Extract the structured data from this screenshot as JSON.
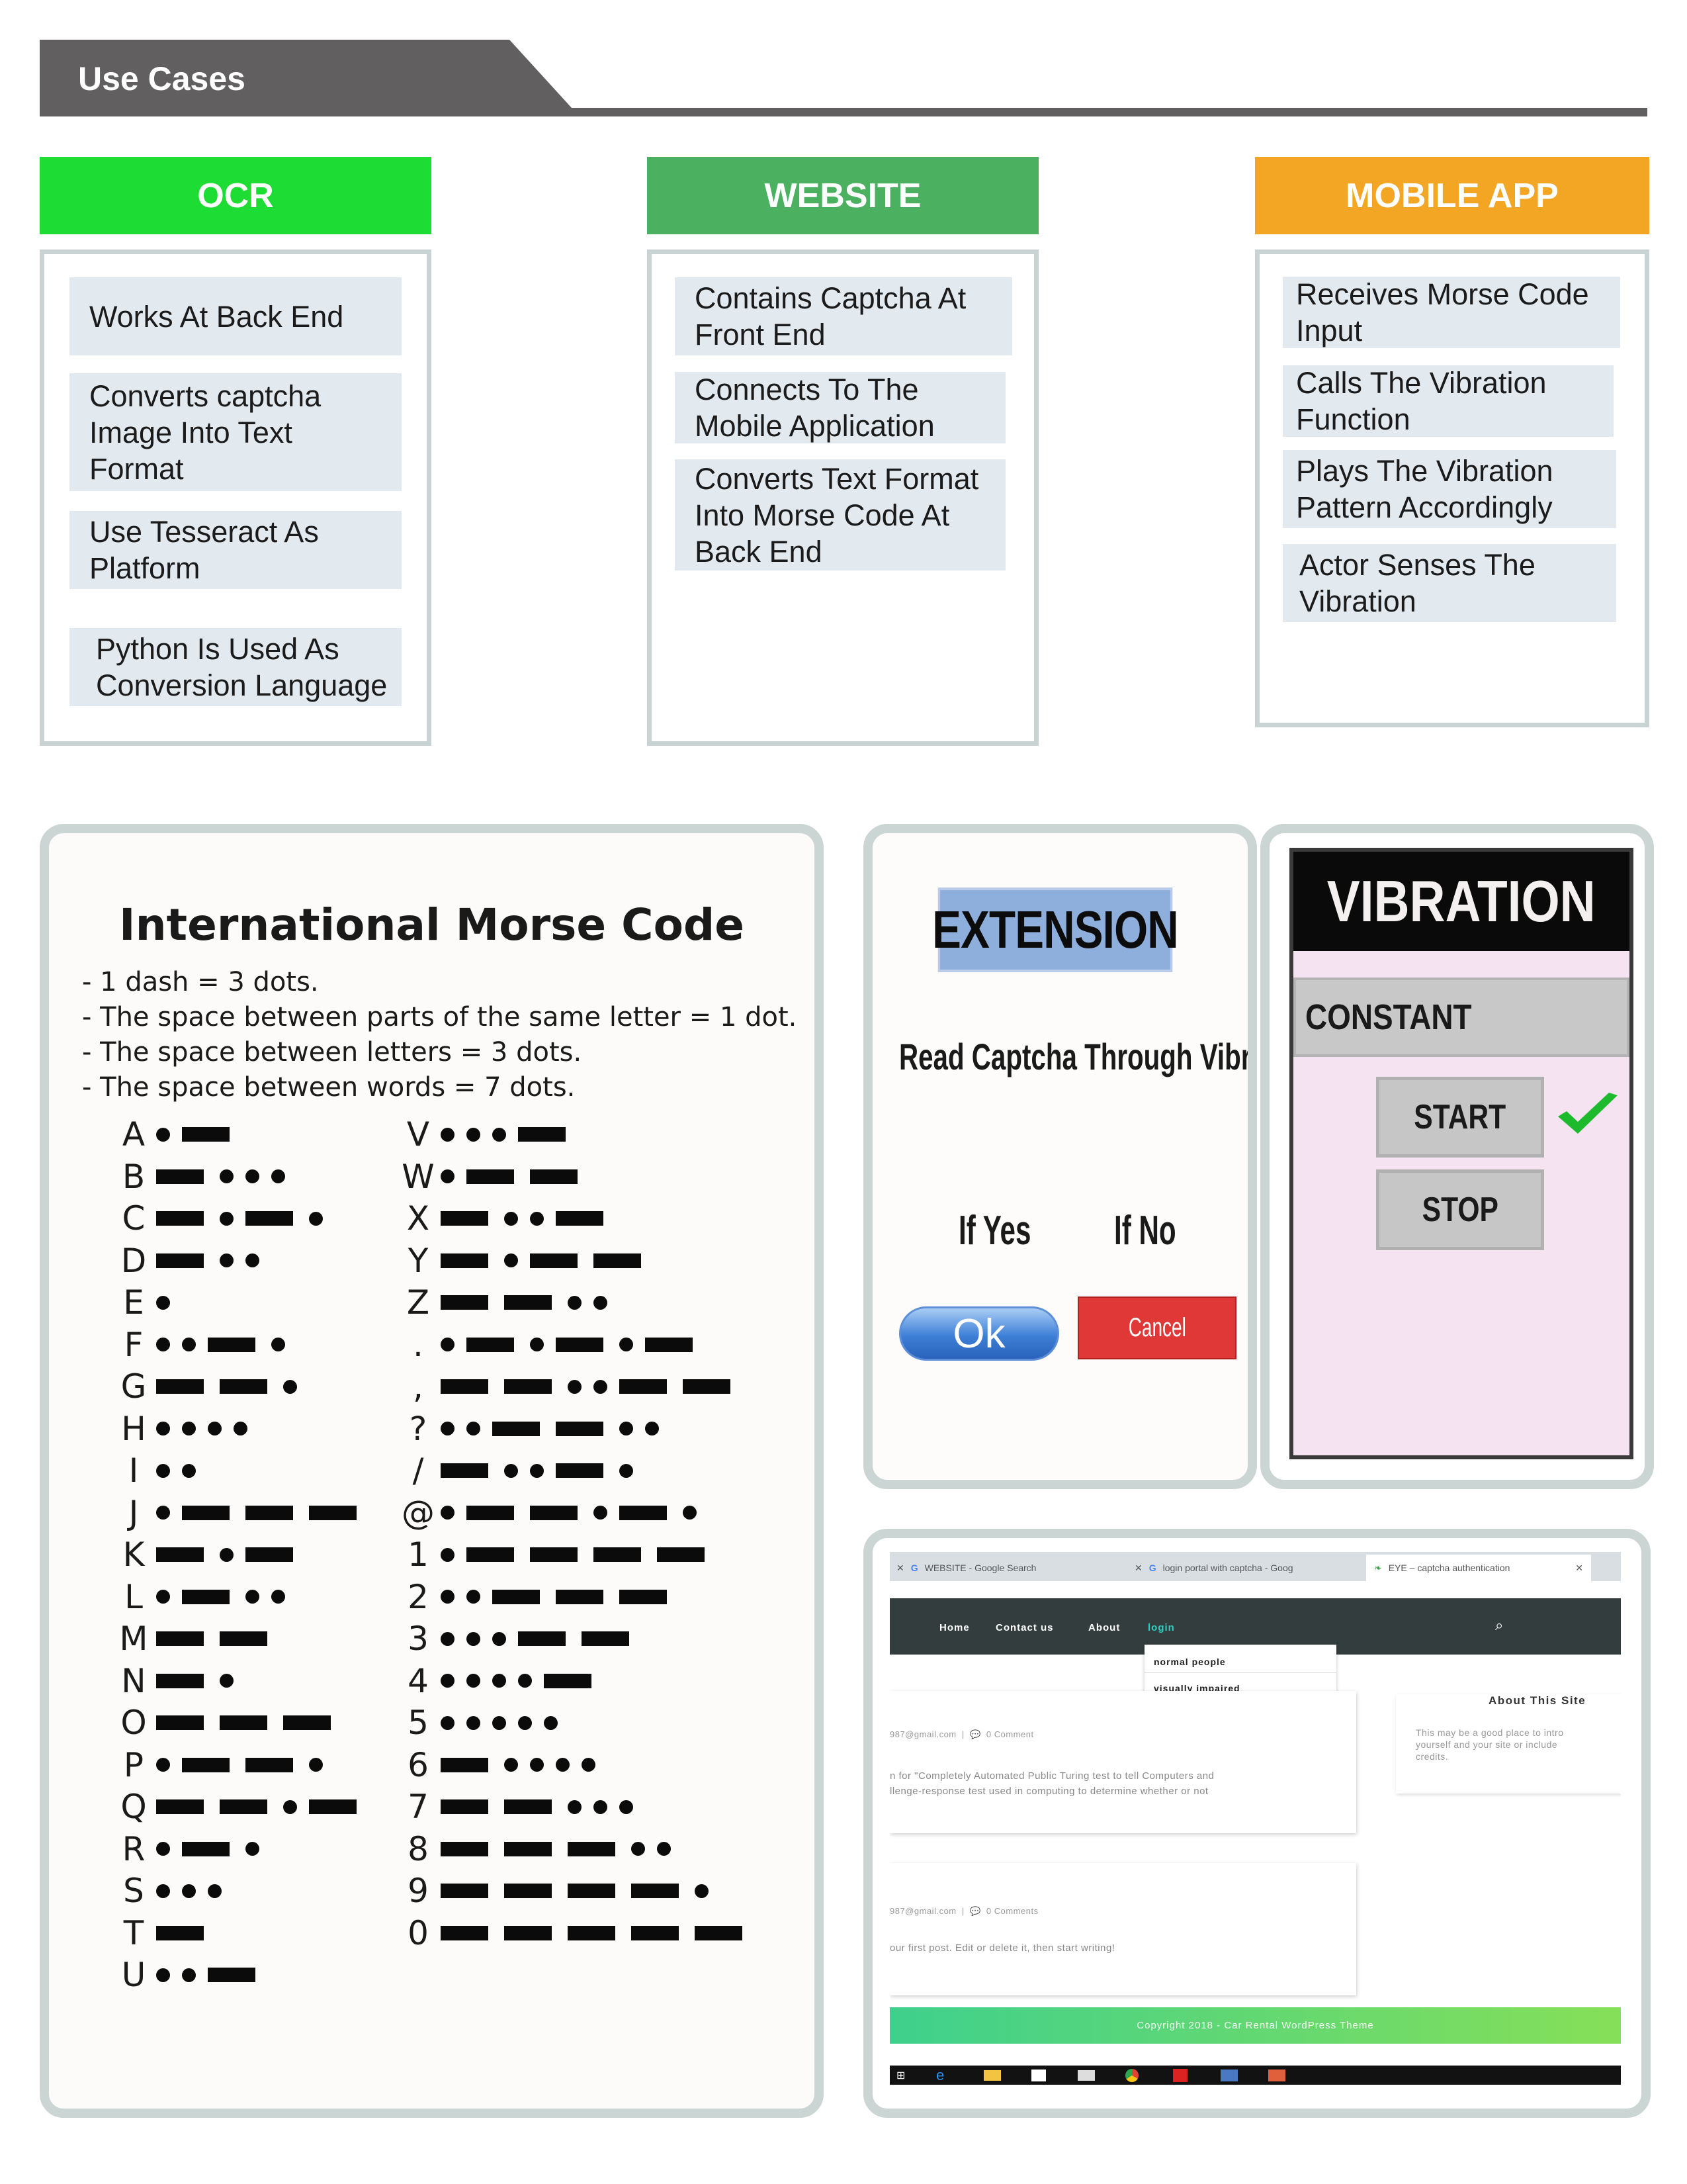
{
  "header": {
    "title": "Use Cases"
  },
  "columns": [
    {
      "title": "OCR",
      "color": "#1ddd34",
      "items": [
        "Works At Back End",
        "Converts captcha Image Into Text Format",
        "Use Tesseract As Platform",
        "Python Is Used As Conversion Language"
      ]
    },
    {
      "title": "WEBSITE",
      "color": "#4cb061",
      "items": [
        "Contains Captcha At Front End",
        "Connects To The Mobile Application",
        "Converts Text Format Into Morse Code At Back End"
      ]
    },
    {
      "title": "MOBILE APP",
      "color": "#f2a624",
      "items": [
        "Receives Morse Code Input",
        "Calls The Vibration Function",
        "Plays The Vibration Pattern Accordingly",
        "Actor Senses The Vibration"
      ]
    }
  ],
  "morse": {
    "title": "International Morse Code",
    "rules": [
      "- 1 dash = 3 dots.",
      "- The space between parts of the same letter = 1 dot.",
      "- The space between letters = 3 dots.",
      "- The space between words = 7 dots."
    ],
    "left": [
      {
        "char": "A",
        "code": ".-"
      },
      {
        "char": "B",
        "code": "-..."
      },
      {
        "char": "C",
        "code": "-.-."
      },
      {
        "char": "D",
        "code": "-.."
      },
      {
        "char": "E",
        "code": "."
      },
      {
        "char": "F",
        "code": "..-."
      },
      {
        "char": "G",
        "code": "--."
      },
      {
        "char": "H",
        "code": "...."
      },
      {
        "char": "I",
        "code": ".."
      },
      {
        "char": "J",
        "code": ".---"
      },
      {
        "char": "K",
        "code": "-.-"
      },
      {
        "char": "L",
        "code": ".-.."
      },
      {
        "char": "M",
        "code": "--"
      },
      {
        "char": "N",
        "code": "-."
      },
      {
        "char": "O",
        "code": "---"
      },
      {
        "char": "P",
        "code": ".--."
      },
      {
        "char": "Q",
        "code": "--.-"
      },
      {
        "char": "R",
        "code": ".-."
      },
      {
        "char": "S",
        "code": "..."
      },
      {
        "char": "T",
        "code": "-"
      },
      {
        "char": "U",
        "code": "..-"
      }
    ],
    "right": [
      {
        "char": "V",
        "code": "...-"
      },
      {
        "char": "W",
        "code": ".--"
      },
      {
        "char": "X",
        "code": "-..-"
      },
      {
        "char": "Y",
        "code": "-.--"
      },
      {
        "char": "Z",
        "code": "--.."
      },
      {
        "char": ".",
        "code": ".-.-.-"
      },
      {
        "char": ",",
        "code": "--..--"
      },
      {
        "char": "?",
        "code": "..--.."
      },
      {
        "char": "/",
        "code": "-..-."
      },
      {
        "char": "@",
        "code": ".--.-."
      },
      {
        "char": "1",
        "code": ".----"
      },
      {
        "char": "2",
        "code": "..---"
      },
      {
        "char": "3",
        "code": "...--"
      },
      {
        "char": "4",
        "code": "....-"
      },
      {
        "char": "5",
        "code": "....."
      },
      {
        "char": "6",
        "code": "-...."
      },
      {
        "char": "7",
        "code": "--..."
      },
      {
        "char": "8",
        "code": "---.."
      },
      {
        "char": "9",
        "code": "----."
      },
      {
        "char": "0",
        "code": "-----"
      }
    ]
  },
  "extension": {
    "title": "EXTENSION",
    "subtitle": "Read Captcha Through Vibration",
    "if_yes": "If Yes",
    "if_no": "If No",
    "ok": "Ok",
    "cancel": "Cancel"
  },
  "vibration": {
    "title": "VIBRATION",
    "constant": "CONSTANT",
    "start": "START",
    "stop": "STOP",
    "check_color": "#1dba2e"
  },
  "website": {
    "tabs": [
      "WEBSITE - Google Search",
      "login portal with captcha - Goog",
      "EYE – captcha authentication"
    ],
    "nav": [
      "Home",
      "Contact us",
      "About",
      "login"
    ],
    "dropdown": [
      "normal people",
      "visually impaired"
    ],
    "sidebar_title": "About This Site",
    "sidebar_text": [
      "This may be a good place to intro",
      "yourself and your site or include",
      "credits."
    ],
    "post1_meta": "987@gmail.com",
    "post1_comments": "0 Comment",
    "post1_text": [
      "n for \"Completely Automated Public Turing test to tell Computers and",
      "llenge-response test used in computing to determine whether or not"
    ],
    "post2_meta": "987@gmail.com",
    "post2_comments": "0 Comments",
    "post2_text": "our first post. Edit or delete it, then start writing!",
    "footer": "Copyright 2018 - Car Rental WordPress Theme",
    "login_color": "#2fd0c2"
  }
}
